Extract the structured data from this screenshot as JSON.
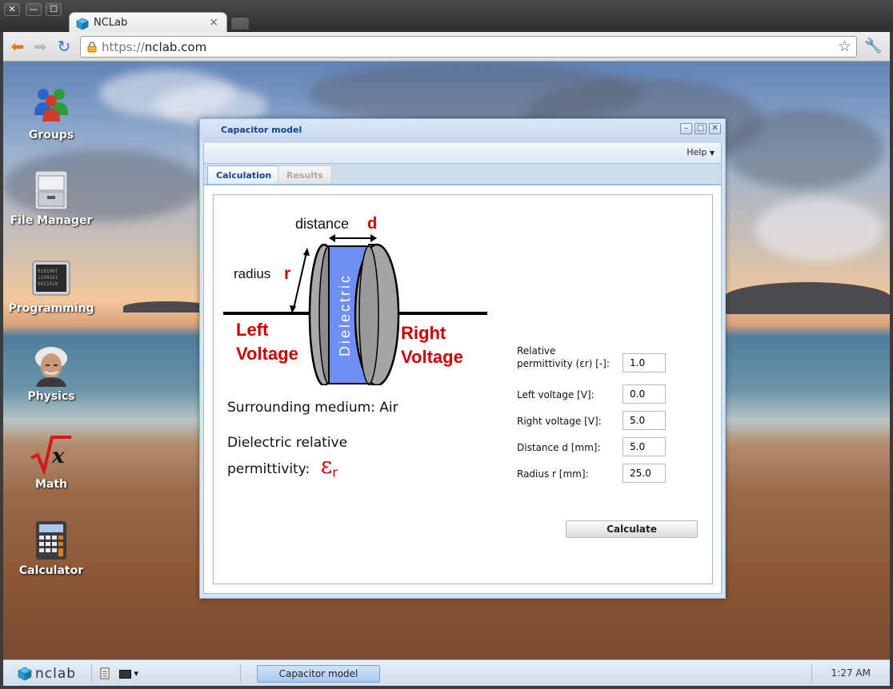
{
  "browser": {
    "window_buttons": [
      "✕",
      "—",
      "☐"
    ],
    "tab_title": "NCLab",
    "tab_close": "×",
    "url_scheme": "https://",
    "url_host": "nclab.com"
  },
  "desktop_icons": [
    {
      "label": "Groups",
      "icon": "groups-icon"
    },
    {
      "label": "File Manager",
      "icon": "file-cabinet-icon"
    },
    {
      "label": "Programming",
      "icon": "binary-monitor-icon"
    },
    {
      "label": "Physics",
      "icon": "einstein-portrait-icon"
    },
    {
      "label": "Math",
      "icon": "square-root-icon"
    },
    {
      "label": "Calculator",
      "icon": "calculator-icon"
    }
  ],
  "window": {
    "title": "Capacitor model",
    "help_menu": "Help",
    "tabs": [
      {
        "label": "Calculation",
        "active": true
      },
      {
        "label": "Results",
        "active": false
      }
    ]
  },
  "diagram": {
    "distance_label": "distance",
    "distance_symbol": "d",
    "radius_label": "radius",
    "radius_symbol": "r",
    "left_voltage": [
      "Left",
      "Voltage"
    ],
    "right_voltage": [
      "Right",
      "Voltage"
    ],
    "dielectric_label": "Dielectric",
    "surrounding_medium": "Surrounding medium: Air",
    "dielectric_line1": "Dielectric relative",
    "dielectric_line2": "permittivity:",
    "epsilon_symbol": "ε",
    "epsilon_subscript": "r"
  },
  "form": {
    "fields": [
      {
        "label_line1": "Relative",
        "label_line2": "permittivity (εr) [-]:",
        "value": "1.0"
      },
      {
        "label_line1": "Left voltage [V]:",
        "label_line2": "",
        "value": "0.0"
      },
      {
        "label_line1": "Right voltage [V]:",
        "label_line2": "",
        "value": "5.0"
      },
      {
        "label_line1": "Distance d [mm]:",
        "label_line2": "",
        "value": "5.0"
      },
      {
        "label_line1": "Radius r [mm]:",
        "label_line2": "",
        "value": "25.0"
      }
    ],
    "calculate_button": "Calculate"
  },
  "taskbar": {
    "logo_text": "nclab",
    "task_label": "Capacitor model",
    "clock": "1:27 AM"
  },
  "colors": {
    "accent_blue": "#15428b",
    "dielectric_blue": "#6f8ff5",
    "label_red": "#cc0000"
  }
}
